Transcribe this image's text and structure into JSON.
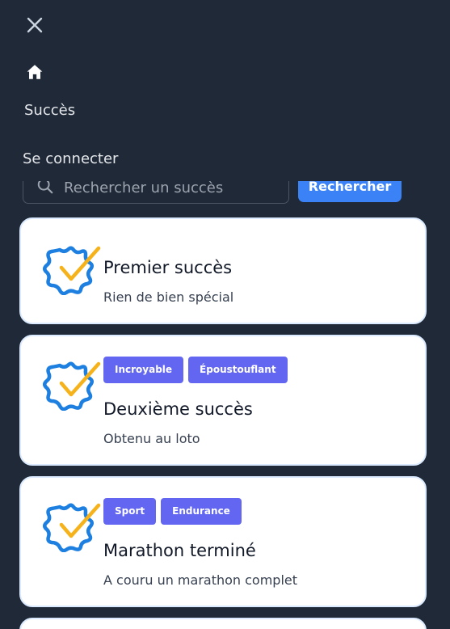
{
  "menu": {
    "close_icon": "close-icon",
    "home_icon": "home-icon",
    "items": [
      {
        "label": "Succès"
      },
      {
        "label": "Se connecter"
      }
    ]
  },
  "search": {
    "placeholder": "Rechercher un succès",
    "value": "",
    "button_label": "Rechercher",
    "icon": "search-icon"
  },
  "colors": {
    "background": "#1f2937",
    "card_border": "#dbeafe",
    "accent_blue": "#3b82f6",
    "tag_purple": "#6366f1",
    "badge_outline": "#1d7fe0",
    "badge_check": "#f5b21a"
  },
  "achievements": [
    {
      "icon": "achievement-badge-icon",
      "tags": [],
      "title": "Premier succès",
      "description": "Rien de bien spécial"
    },
    {
      "icon": "achievement-badge-icon",
      "tags": [
        "Incroyable",
        "Époustouflant"
      ],
      "title": "Deuxième succès",
      "description": "Obtenu au loto"
    },
    {
      "icon": "achievement-badge-icon",
      "tags": [
        "Sport",
        "Endurance"
      ],
      "title": "Marathon terminé",
      "description": "A couru un marathon complet"
    }
  ]
}
